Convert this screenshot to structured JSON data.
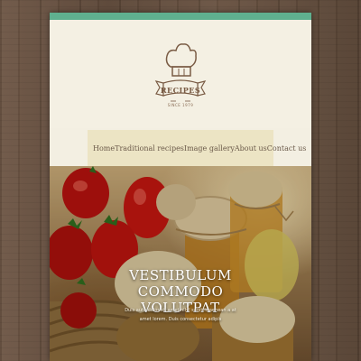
{
  "logo": {
    "name": "RECIPES",
    "tagline": "SINCE 1979"
  },
  "nav": {
    "items": [
      {
        "label": "Home"
      },
      {
        "label": "Traditional recipes"
      },
      {
        "label": "Image gallery"
      },
      {
        "label": "About us"
      },
      {
        "label": "Contact us"
      }
    ]
  },
  "hero": {
    "title_line1": "VESTIBULUM",
    "title_line2": "COMMODO VOLUTPAT",
    "subtitle_line1": "Duis aute dolor sit amet nihil sagittis aenean a at",
    "subtitle_line2": "amet lorem. Duis consectetur adipis"
  },
  "colors": {
    "accent_strip": "#5fb08f",
    "page_bg": "#f3efe2",
    "nav_bg": "#ece4c4",
    "wood": "#6b5443",
    "logo_brown": "#7a5c45"
  }
}
